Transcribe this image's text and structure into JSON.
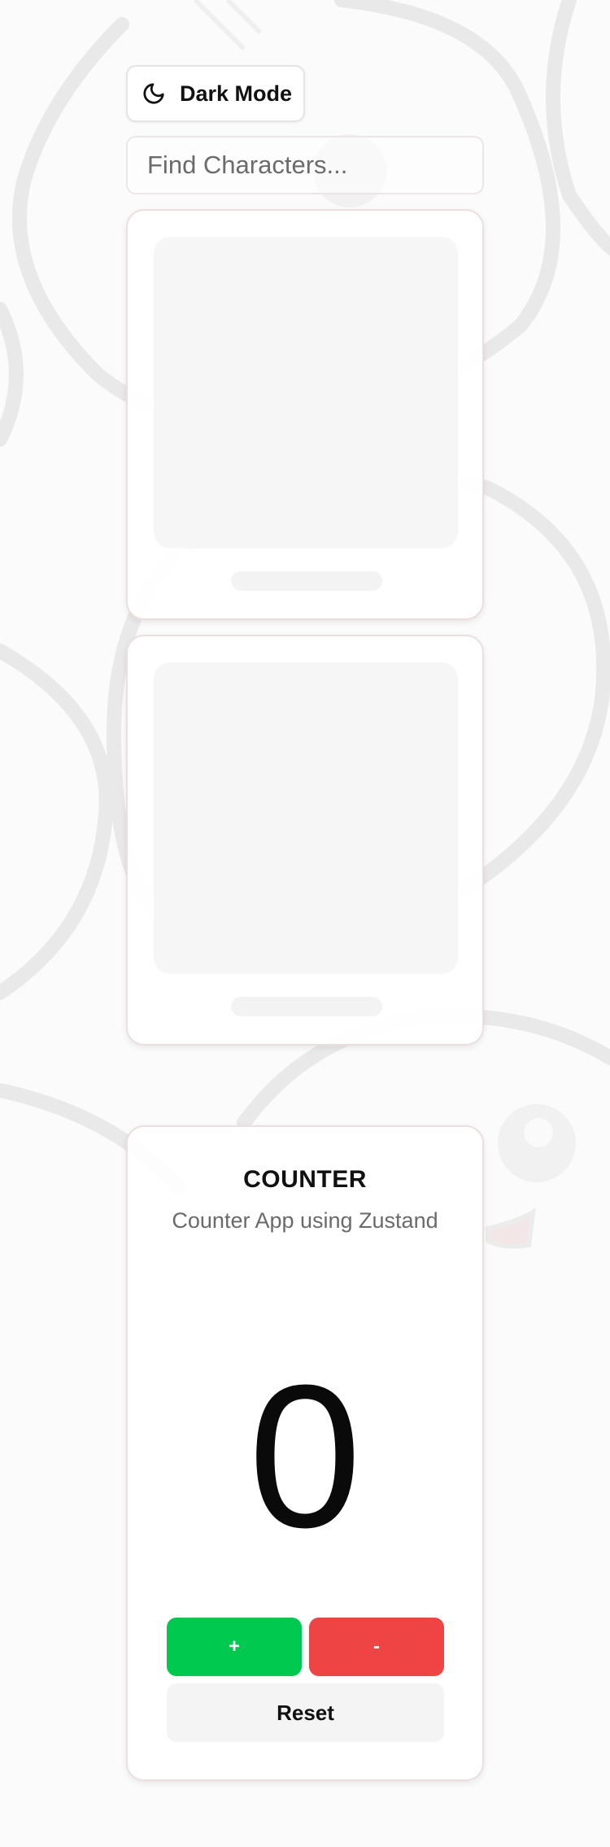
{
  "header": {
    "dark_mode_label": "Dark Mode",
    "dark_mode_icon": "moon-icon"
  },
  "search": {
    "placeholder": "Find Characters...",
    "value": ""
  },
  "skeleton_cards": [
    {
      "state": "loading"
    },
    {
      "state": "loading"
    }
  ],
  "counter": {
    "title": "COUNTER",
    "subtitle": "Counter App using Zustand",
    "value": "0",
    "increment_label": "+",
    "decrement_label": "-",
    "reset_label": "Reset"
  },
  "colors": {
    "page_bg": "#fbfbfb",
    "increment": "#00c950",
    "decrement": "#ef4444",
    "reset_bg": "#f4f4f5",
    "card_border": "#ecdede"
  }
}
